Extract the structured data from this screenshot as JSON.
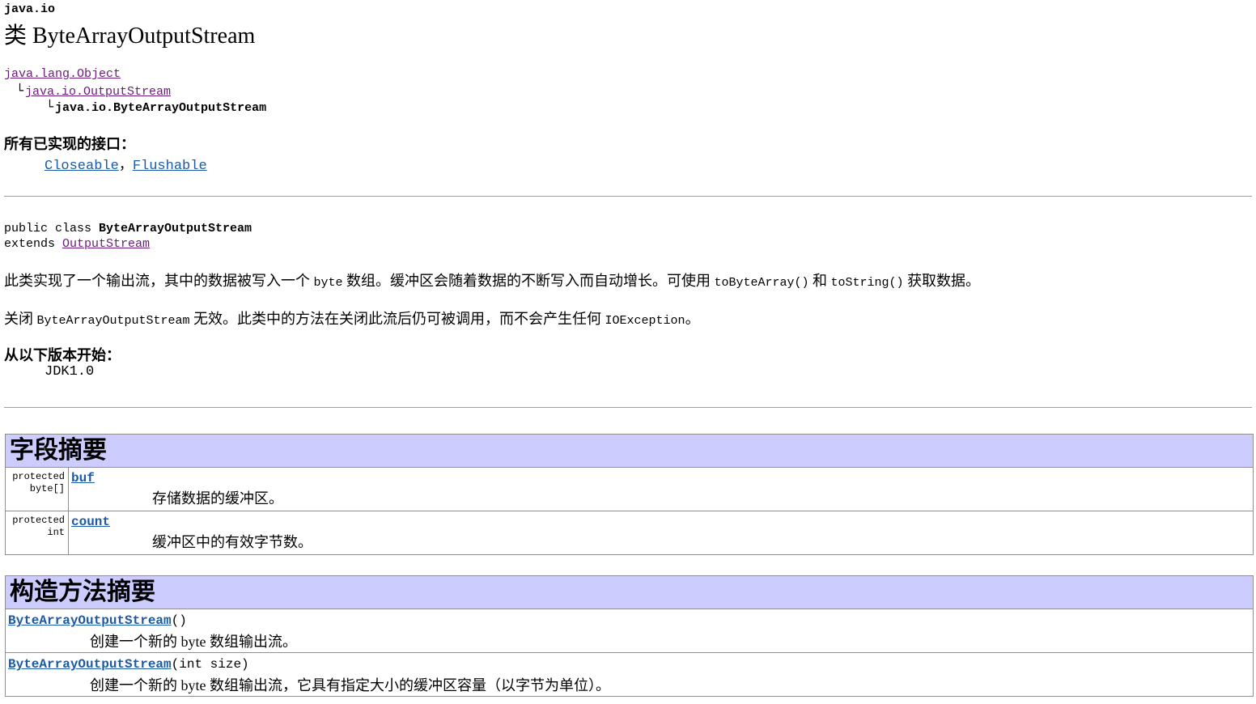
{
  "package_label": "java.io",
  "title": "类 ByteArrayOutputStream",
  "hierarchy": {
    "root": "java.lang.Object",
    "parent": "java.io.OutputStream",
    "current": "java.io.ByteArrayOutputStream"
  },
  "interfaces": {
    "label": "所有已实现的接口：",
    "items": [
      "Closeable",
      "Flushable"
    ],
    "separator": "，"
  },
  "declaration": {
    "line1_prefix": "public class ",
    "line1_name": "ByteArrayOutputStream",
    "line2_prefix": "extends ",
    "line2_link": "OutputStream"
  },
  "description": {
    "p1": {
      "a": "此类实现了一个输出流，其中的数据被写入一个 ",
      "b": "byte",
      "c": " 数组。缓冲区会随着数据的不断写入而自动增长。可使用 ",
      "d": "toByteArray()",
      "e": " 和 ",
      "f": "toString()",
      "g": " 获取数据。"
    },
    "p2": {
      "a": "关闭 ",
      "b": "ByteArrayOutputStream",
      "c": " 无效。此类中的方法在关闭此流后仍可被调用，而不会产生任何 ",
      "d": "IOException",
      "e": "。"
    }
  },
  "since": {
    "label": "从以下版本开始：",
    "value": "JDK1.0"
  },
  "field_summary": {
    "heading": "字段摘要",
    "rows": [
      {
        "modifier": "protected",
        "type": "byte[]",
        "name": "buf",
        "desc": "存储数据的缓冲区。"
      },
      {
        "modifier": "protected",
        "type": "int",
        "name": "count",
        "desc": "缓冲区中的有效字节数。"
      }
    ]
  },
  "constructor_summary": {
    "heading": "构造方法摘要",
    "rows": [
      {
        "name": "ByteArrayOutputStream",
        "params": "()",
        "desc": "创建一个新的 byte 数组输出流。"
      },
      {
        "name": "ByteArrayOutputStream",
        "params": "(int size)",
        "desc": "创建一个新的 byte 数组输出流，它具有指定大小的缓冲区容量（以字节为单位）。"
      }
    ]
  },
  "colors": {
    "header_bg": "#ccccff",
    "link": "#1a5aa8",
    "visited_link": "#6b1b7a",
    "border": "#8f8f8f"
  }
}
